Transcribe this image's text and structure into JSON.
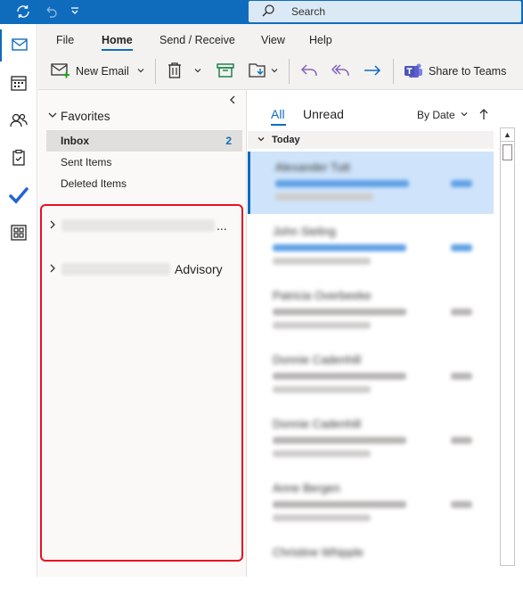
{
  "titlebar": {
    "icons": [
      "sync-icon",
      "undo-icon",
      "customize-icon"
    ]
  },
  "search": {
    "placeholder": "Search"
  },
  "nav_rail": {
    "items": [
      "mail",
      "calendar",
      "people",
      "tasks",
      "todo",
      "apps"
    ],
    "active": "mail"
  },
  "ribbon_tabs": [
    "File",
    "Home",
    "Send / Receive",
    "View",
    "Help"
  ],
  "ribbon_tabs_active": "Home",
  "ribbon": {
    "new_email": "New Email",
    "share_to_teams": "Share to Teams"
  },
  "folder_pane": {
    "favorites_label": "Favorites",
    "favorites": [
      {
        "label": "Inbox",
        "count": "2"
      },
      {
        "label": "Sent Items",
        "count": ""
      },
      {
        "label": "Deleted Items",
        "count": ""
      }
    ],
    "accounts": [
      {
        "suffix": "..."
      },
      {
        "suffix": "Advisory"
      }
    ]
  },
  "message_list": {
    "filters": {
      "all": "All",
      "unread": "Unread"
    },
    "sort": "By Date",
    "group_header": "Today",
    "messages": [
      {
        "sender": "Alexander Tutt"
      },
      {
        "sender": "John Sieling"
      },
      {
        "sender": "Patricia Overbeeke"
      },
      {
        "sender": "Donnie Cadenhill"
      },
      {
        "sender": "Donnie Cadenhill"
      },
      {
        "sender": "Anne Bergen"
      },
      {
        "sender": "Christine Whipple"
      }
    ]
  },
  "colors": {
    "accent": "#0f6cbd",
    "highlight": "#e81123"
  }
}
